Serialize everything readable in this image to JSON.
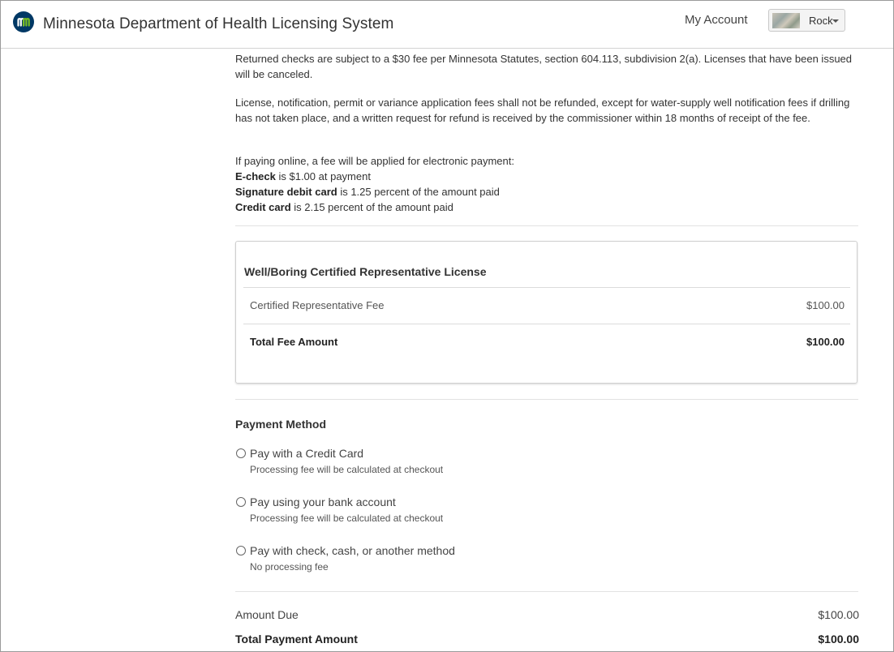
{
  "header": {
    "app_title": "Minnesota Department of Health Licensing System",
    "my_account_label": "My Account",
    "user_name": "Rock",
    "logo_icon": "mn-logo-icon",
    "brand_color": "#003865"
  },
  "notices": {
    "returned_checks": "Returned checks are subject to a $30 fee per Minnesota Statutes, section 604.113, subdivision 2(a). Licenses that have been issued will be canceled.",
    "refund_policy": "License, notification, permit or variance application fees shall not be refunded, except for water-supply well notification fees if drilling has not taken place, and a written request for refund is received by the commissioner within 18 months of receipt of the fee.",
    "online_fee_intro": "If paying online, a fee will be applied for electronic payment:",
    "echeck_bold": "E-check",
    "echeck_rest": " is $1.00 at payment",
    "debit_bold": "Signature debit card",
    "debit_rest": " is 1.25 percent of the amount paid",
    "credit_bold": "Credit card",
    "credit_rest": " is 2.15 percent of the amount paid"
  },
  "fee_card": {
    "title": "Well/Boring Certified Representative License",
    "line_item_label": "Certified Representative Fee",
    "line_item_amount": "$100.00",
    "total_label": "Total Fee Amount",
    "total_amount": "$100.00"
  },
  "payment_method": {
    "title": "Payment Method",
    "options": [
      {
        "label": "Pay with a Credit Card",
        "sub": "Processing fee will be calculated at checkout",
        "selected": false
      },
      {
        "label": "Pay using your bank account",
        "sub": "Processing fee will be calculated at checkout",
        "selected": false
      },
      {
        "label": "Pay with check, cash, or another method",
        "sub": "No processing fee",
        "selected": false
      }
    ]
  },
  "summary": {
    "amount_due_label": "Amount Due",
    "amount_due": "$100.00",
    "total_payment_label": "Total Payment Amount",
    "total_payment": "$100.00"
  }
}
